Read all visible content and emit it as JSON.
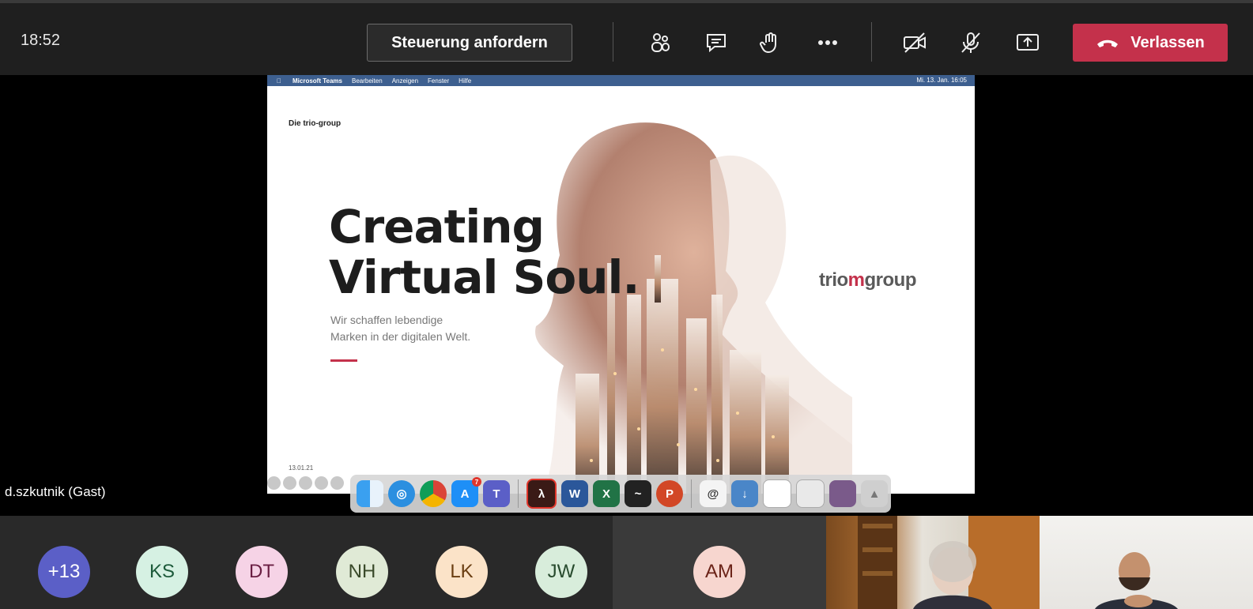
{
  "meeting": {
    "time": "18:52",
    "request_control_label": "Steuerung anfordern",
    "leave_label": "Verlassen"
  },
  "toolbar_icons": [
    "people-icon",
    "chat-icon",
    "raise-hand-icon",
    "more-icon",
    "camera-off-icon",
    "mic-off-icon",
    "share-screen-icon",
    "phone-hangup-icon"
  ],
  "shared_screen": {
    "menubar": {
      "app": "Microsoft Teams",
      "items": [
        "Bearbeiten",
        "Anzeigen",
        "Fenster",
        "Hilfe"
      ],
      "clock": "Mi. 13. Jan. 16:05"
    },
    "slide": {
      "brand": "Die trio-group",
      "title_line1": "Creating",
      "title_line2": "Virtual Soul.",
      "subtitle_line1": "Wir schaffen lebendige",
      "subtitle_line2": "Marken in der digitalen Welt.",
      "date": "13.01.21",
      "logo_part1": "trio",
      "logo_mark": "m",
      "logo_part2": "group"
    },
    "dock_apps": [
      "Finder",
      "Safari",
      "Chrome",
      "App Store",
      "Teams",
      "Acrobat",
      "Word",
      "Excel",
      "Activity Monitor",
      "PowerPoint",
      "Mail",
      "Downloads",
      "Documents",
      "Screenshots",
      "Photos",
      "Trash"
    ],
    "app_store_badge": "7"
  },
  "presenter_name": "d.szkutnik (Gast)",
  "participants": [
    {
      "initials": "+13",
      "color": "#5b5fc7",
      "text_color": "#ffffff"
    },
    {
      "initials": "KS",
      "color": "#d6f1e3",
      "text_color": "#1c5a3a"
    },
    {
      "initials": "DT",
      "color": "#f6d3e6",
      "text_color": "#6a1f43"
    },
    {
      "initials": "NH",
      "color": "#e0ead6",
      "text_color": "#3a4a2a"
    },
    {
      "initials": "LK",
      "color": "#fbe3c8",
      "text_color": "#6a3e12"
    },
    {
      "initials": "JW",
      "color": "#d8eddb",
      "text_color": "#274a2d"
    },
    {
      "initials": "AM",
      "color": "#f7d6cf",
      "text_color": "#6b2318"
    }
  ]
}
